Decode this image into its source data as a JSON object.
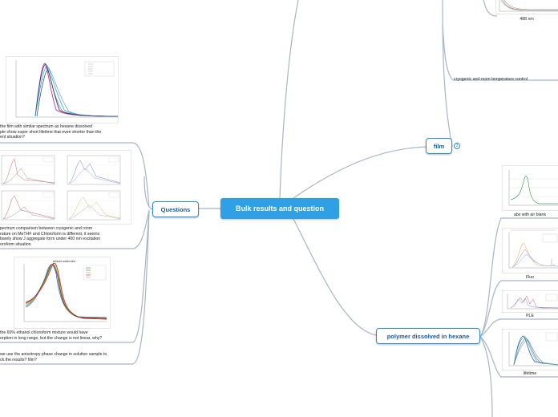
{
  "central": {
    "title": "Bulk results and question"
  },
  "branches": {
    "film": {
      "label": "film",
      "badge": "3"
    },
    "questions": {
      "label": "Questions"
    },
    "polymer": {
      "label": "polymer dissolved in hexane"
    }
  },
  "film_children": {
    "nm488": "488 nm",
    "cryo": "cryogenic and room temperature control"
  },
  "polymer_children": {
    "abs": "abs with air blank",
    "fluo": "Fluo",
    "ple": "PLE",
    "lifetime": "lifetime"
  },
  "questions_children": {
    "q1": [
      "the film with similar spectrum as hexane dissolved",
      "ple show super short lifetime that even shorter than the",
      "ent situation?"
    ],
    "q2": [
      "pectrum comparison between cryogenic and room",
      "rature on MeTHF and Chloroform is different, it seems",
      "barely show J aggregate form under 400 nm excitation",
      "oroform situation"
    ],
    "q3": [
      "the 60% ethanol chloroform mixture would have",
      "orption in long range, but the change is not linear, why?"
    ],
    "q4": [
      "we use the anisotropy phase change in solution sample to",
      "ck the results? film?"
    ],
    "q3_plot_title": "ethanol added abs"
  },
  "colors": {
    "central_bg": "#2f9fe6",
    "branch_border": "#2a8fdb",
    "branch_text": "#1b5a9c",
    "link": "#a9b4c6"
  }
}
